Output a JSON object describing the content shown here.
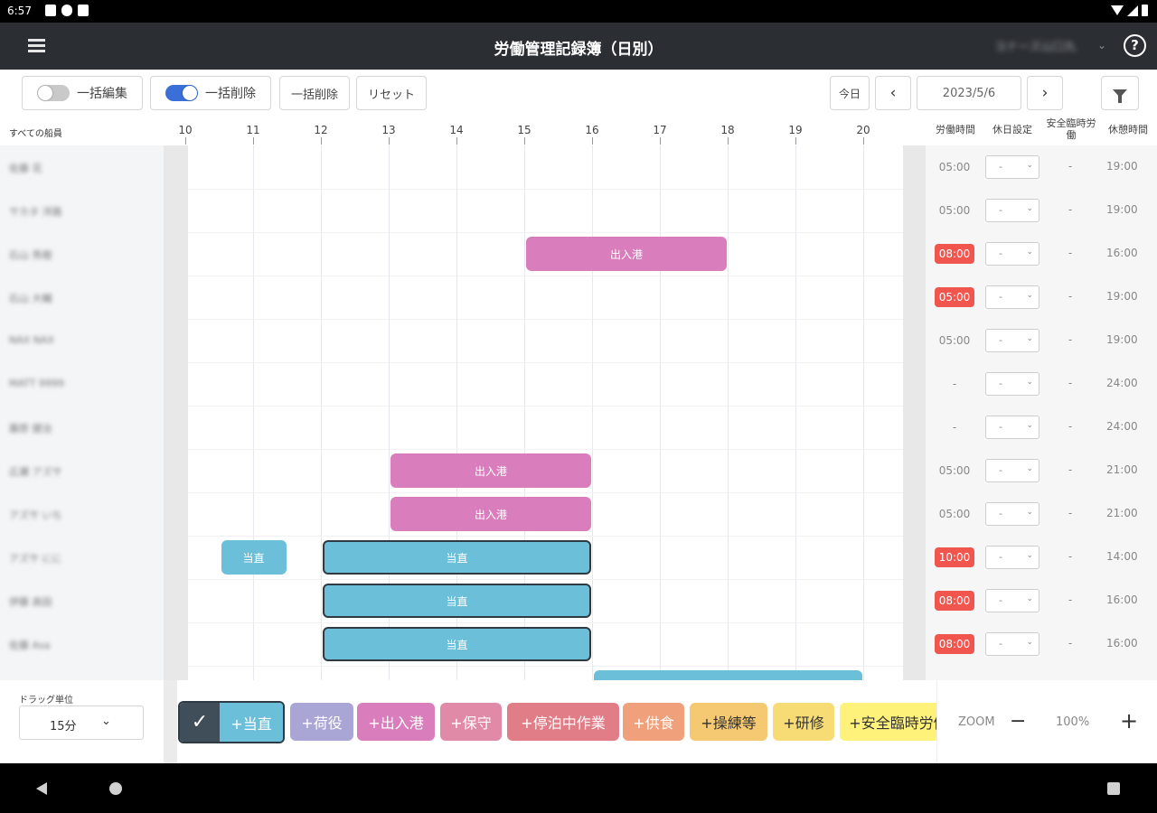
{
  "status": {
    "time": "6:57"
  },
  "appbar": {
    "title": "労働管理記録簿（日別）",
    "user": "ヨナーズ山口丸"
  },
  "toolbar": {
    "bulk_edit": "一括編集",
    "bulk_edit_on": false,
    "bulk_delete_toggle": "一括削除",
    "bulk_delete_on": true,
    "bulk_delete_button": "一括削除",
    "reset": "リセット",
    "today": "今日",
    "prev": "‹",
    "date": "2023/5/6",
    "next": "›"
  },
  "schedule": {
    "all_members": "すべての船員",
    "hours": [
      "10",
      "11",
      "12",
      "13",
      "14",
      "15",
      "16",
      "17",
      "18",
      "19",
      "20"
    ],
    "columns": {
      "work_hours": "労働時間",
      "holiday_setting": "休日設定",
      "safety_overtime": "安全臨時労働",
      "rest_hours": "休憩時間"
    },
    "rows": [
      {
        "name": "佐藤 花",
        "work": "05:00",
        "alert": false,
        "holiday": "-",
        "safety": "-",
        "rest": "19:00"
      },
      {
        "name": "サカタ 洋路",
        "work": "05:00",
        "alert": false,
        "holiday": "-",
        "safety": "-",
        "rest": "19:00"
      },
      {
        "name": "石山 秀樹",
        "work": "08:00",
        "alert": true,
        "holiday": "-",
        "safety": "-",
        "rest": "16:00"
      },
      {
        "name": "石山 大輔",
        "work": "05:00",
        "alert": true,
        "holiday": "-",
        "safety": "-",
        "rest": "19:00"
      },
      {
        "name": "NAX NAX",
        "work": "05:00",
        "alert": false,
        "holiday": "-",
        "safety": "-",
        "rest": "19:00"
      },
      {
        "name": "MATT 9999",
        "work": "-",
        "alert": false,
        "holiday": "-",
        "safety": "-",
        "rest": "24:00"
      },
      {
        "name": "藤原 健治",
        "work": "-",
        "alert": false,
        "holiday": "-",
        "safety": "-",
        "rest": "24:00"
      },
      {
        "name": "広瀬 アズサ",
        "work": "05:00",
        "alert": false,
        "holiday": "-",
        "safety": "-",
        "rest": "21:00"
      },
      {
        "name": "アズサ いち",
        "work": "05:00",
        "alert": false,
        "holiday": "-",
        "safety": "-",
        "rest": "21:00"
      },
      {
        "name": "アズサ にに",
        "work": "10:00",
        "alert": true,
        "holiday": "-",
        "safety": "-",
        "rest": "14:00"
      },
      {
        "name": "伊藤 高田",
        "work": "08:00",
        "alert": true,
        "holiday": "-",
        "safety": "-",
        "rest": "16:00"
      },
      {
        "name": "佐藤 Asa",
        "work": "08:00",
        "alert": true,
        "holiday": "-",
        "safety": "-",
        "rest": "16:00"
      }
    ],
    "bars": [
      {
        "row": 2,
        "start": 15.0,
        "end": 18.0,
        "label": "出入港",
        "kind": "pink",
        "selected": false
      },
      {
        "row": 7,
        "start": 13.0,
        "end": 16.0,
        "label": "出入港",
        "kind": "pink",
        "selected": false
      },
      {
        "row": 8,
        "start": 13.0,
        "end": 16.0,
        "label": "出入港",
        "kind": "pink",
        "selected": false
      },
      {
        "row": 9,
        "start": 10.5,
        "end": 11.5,
        "label": "当直",
        "kind": "blue",
        "selected": false
      },
      {
        "row": 9,
        "start": 12.0,
        "end": 16.0,
        "label": "当直",
        "kind": "blue",
        "selected": true
      },
      {
        "row": 10,
        "start": 12.0,
        "end": 16.0,
        "label": "当直",
        "kind": "blue",
        "selected": true
      },
      {
        "row": 11,
        "start": 12.0,
        "end": 16.0,
        "label": "当直",
        "kind": "blue",
        "selected": true
      },
      {
        "row": 12,
        "start": 16.0,
        "end": 20.0,
        "label": "",
        "kind": "blue",
        "selected": false
      }
    ]
  },
  "footer": {
    "drag_unit_label": "ドラッグ単位",
    "drag_unit_value": "15分",
    "categories": [
      {
        "label": "+当直",
        "color": "#6cbfd8",
        "text": "#ffffff",
        "active": true
      },
      {
        "label": "+荷役",
        "color": "#a9a6d6",
        "text": "#ffffff"
      },
      {
        "label": "+出入港",
        "color": "#d97dbc",
        "text": "#ffffff"
      },
      {
        "label": "+保守",
        "color": "#e08aa8",
        "text": "#ffffff"
      },
      {
        "label": "+停泊中作業",
        "color": "#e07d87",
        "text": "#ffffff"
      },
      {
        "label": "+供食",
        "color": "#f0a07b",
        "text": "#ffffff"
      },
      {
        "label": "+操練等",
        "color": "#f5c872",
        "text": "#333333"
      },
      {
        "label": "+研修",
        "color": "#f7dc76",
        "text": "#333333"
      },
      {
        "label": "+安全臨時労働",
        "color": "#fff27a",
        "text": "#333333"
      }
    ],
    "zoom_label": "ZOOM",
    "zoom_minus": "−",
    "zoom_value": "100%",
    "zoom_plus": "+"
  }
}
